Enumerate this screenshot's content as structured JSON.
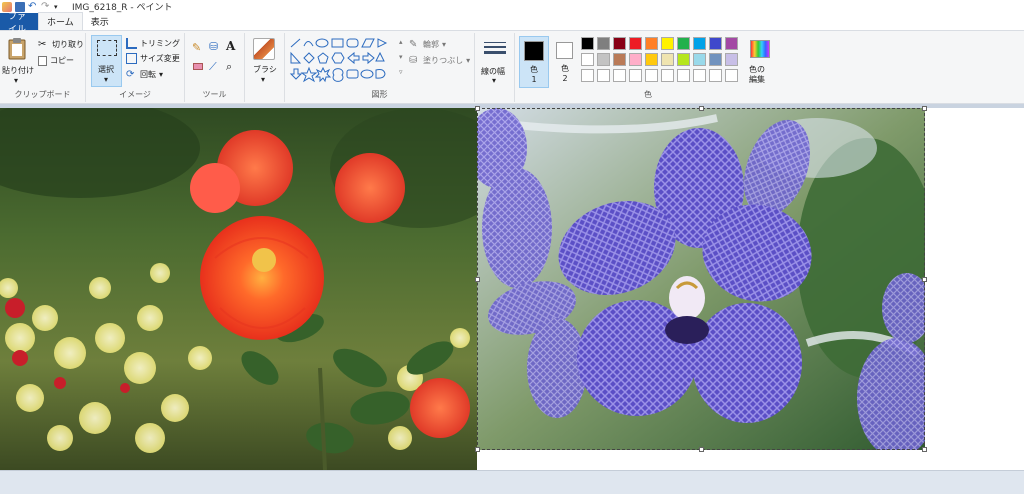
{
  "window": {
    "title": "IMG_6218_R - ペイント"
  },
  "tabs": {
    "file": "ファイル",
    "home": "ホーム",
    "view": "表示"
  },
  "clipboard": {
    "paste": "貼り付け",
    "cut": "切り取り",
    "copy": "コピー",
    "label": "クリップボード"
  },
  "image": {
    "select": "選択",
    "crop": "トリミング",
    "resize": "サイズ変更",
    "rotate": "回転",
    "label": "イメージ"
  },
  "tools": {
    "label": "ツール"
  },
  "brush": {
    "label": "ブラシ"
  },
  "shapes": {
    "outline": "輪郭",
    "fill": "塗りつぶし",
    "label": "図形"
  },
  "size": {
    "label": "線の幅"
  },
  "colors": {
    "color1": "色\n1",
    "color2": "色\n2",
    "edit": "色の\n編集",
    "label": "色",
    "color1_value": "#000000",
    "color2_value": "#ffffff",
    "palette_row1": [
      "#000000",
      "#7f7f7f",
      "#880015",
      "#ed1c24",
      "#ff7f27",
      "#fff200",
      "#22b14c",
      "#00a2e8",
      "#3f48cc",
      "#a349a4"
    ],
    "palette_row2": [
      "#ffffff",
      "#c3c3c3",
      "#b97a57",
      "#ffaec9",
      "#ffc90e",
      "#efe4b0",
      "#b5e61d",
      "#99d9ea",
      "#7092be",
      "#c8bfe7"
    ],
    "palette_row3": [
      "#ffffff",
      "#ffffff",
      "#ffffff",
      "#ffffff",
      "#ffffff",
      "#ffffff",
      "#ffffff",
      "#ffffff",
      "#ffffff",
      "#ffffff"
    ]
  }
}
